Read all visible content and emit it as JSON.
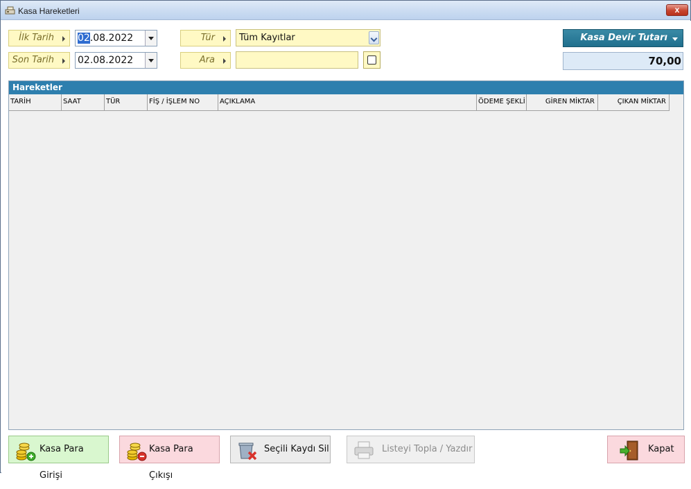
{
  "window": {
    "title": "Kasa Hareketleri",
    "close_label": "x"
  },
  "filters": {
    "ilk_tarih_label": "İlk Tarih",
    "ilk_tarih_selected": "02",
    "ilk_tarih_rest": ".08.2022",
    "son_tarih_label": "Son Tarih",
    "son_tarih_value": "02.08.2022",
    "tur_label": "Tür",
    "tur_value": "Tüm Kayıtlar",
    "ara_label": "Ara",
    "ara_value": ""
  },
  "devir": {
    "label": "Kasa Devir Tutarı",
    "amount": "70,00"
  },
  "panel": {
    "title": "Hareketler"
  },
  "columns": [
    "TARİH",
    "SAAT",
    "TÜR",
    "FİŞ / İŞLEM NO",
    "AÇIKLAMA",
    "ÖDEME ŞEKLİ",
    "GİREN MİKTAR",
    "ÇIKAN MİKTAR"
  ],
  "rows": [],
  "buttons": {
    "giris": "Kasa Para Girişi",
    "cikis": "Kasa Para Çıkışı",
    "sil": "Seçili Kaydı Sil",
    "yazdir": "Listeyi Topla / Yazdır",
    "kapat": "Kapat"
  },
  "colors": {
    "accent": "#2e7fae",
    "label_bg": "#fff9c4",
    "devir_bg": "#1f6f8d",
    "amount_bg": "#ddeaf7"
  }
}
